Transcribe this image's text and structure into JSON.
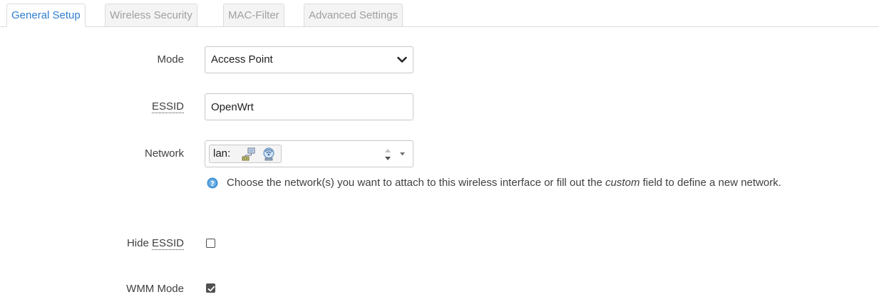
{
  "tabs": [
    {
      "label": "General Setup",
      "active": true
    },
    {
      "label": "Wireless Security",
      "active": false
    },
    {
      "label": "MAC-Filter",
      "active": false
    },
    {
      "label": "Advanced Settings",
      "active": false
    }
  ],
  "form": {
    "mode": {
      "label": "Mode",
      "value": "Access Point"
    },
    "essid": {
      "label": "ESSID",
      "value": "OpenWrt"
    },
    "network": {
      "label": "Network",
      "chip_text": "lan:",
      "icons": [
        "network-switch-icon",
        "wireless-network-icon"
      ],
      "help_text_before": "Choose the network(s) you want to attach to this wireless interface or fill out the ",
      "help_text_em": "custom",
      "help_text_after": " field to define a new network."
    },
    "hide_essid": {
      "label_prefix": "Hide ",
      "label_abbr": "ESSID",
      "checked": false
    },
    "wmm_mode": {
      "label": "WMM Mode",
      "checked": true
    }
  },
  "colors": {
    "active_tab": "#2f7fd0",
    "inactive_tab": "#a0a0a0",
    "help_icon": "#3d8fd1"
  }
}
